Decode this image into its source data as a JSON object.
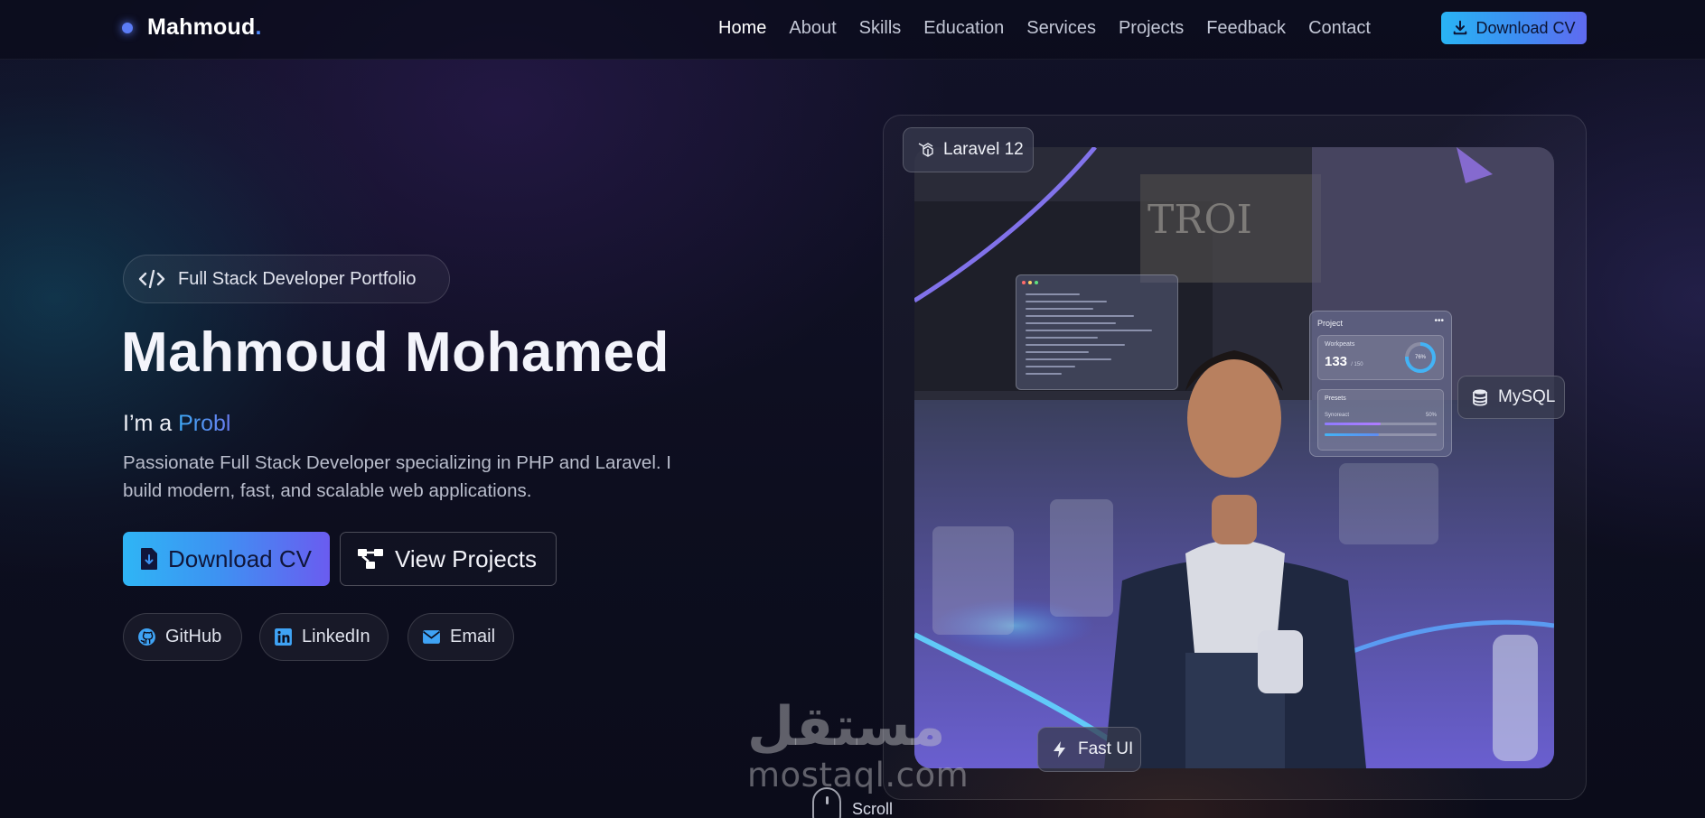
{
  "brand": {
    "name": "Mahmoud",
    "accent": "."
  },
  "nav": {
    "links": [
      "Home",
      "About",
      "Skills",
      "Education",
      "Services",
      "Projects",
      "Feedback",
      "Contact"
    ],
    "active": "Home",
    "cv_button": "Download CV"
  },
  "hero": {
    "badge": "Full Stack Developer Portfolio",
    "title": "Mahmoud Mohamed",
    "sub_prefix": "I’m a ",
    "sub_typed": "Probl",
    "description": "Passionate Full Stack Developer specializing in PHP and Laravel. I build modern, fast, and scalable web applications.",
    "primary_button": "Download CV",
    "secondary_button": "View Projects",
    "social": {
      "github": "GitHub",
      "linkedin": "LinkedIn",
      "email": "Email"
    }
  },
  "visual": {
    "chip_laravel": "Laravel 12",
    "chip_mysql": "MySQL",
    "chip_fast": "Fast UI",
    "project_card": {
      "title": "Project",
      "more": "•••",
      "metric_label": "Workpeats",
      "metric_value": "133",
      "metric_unit": "/ 150",
      "ring_percent": "76%",
      "presets_label": "Presets",
      "row_label": "Synoreact",
      "row_value": "50%"
    },
    "storefront_sign": "TROI"
  },
  "watermark": {
    "arabic": "مستقل",
    "latin": "mostaql.com"
  },
  "scroll": {
    "label": "Scroll"
  },
  "colors": {
    "accent": "#4f8cff",
    "background": "#0c0d1c",
    "primary_gradient_start": "#2fb5f5",
    "primary_gradient_end": "#6a5cf0"
  }
}
